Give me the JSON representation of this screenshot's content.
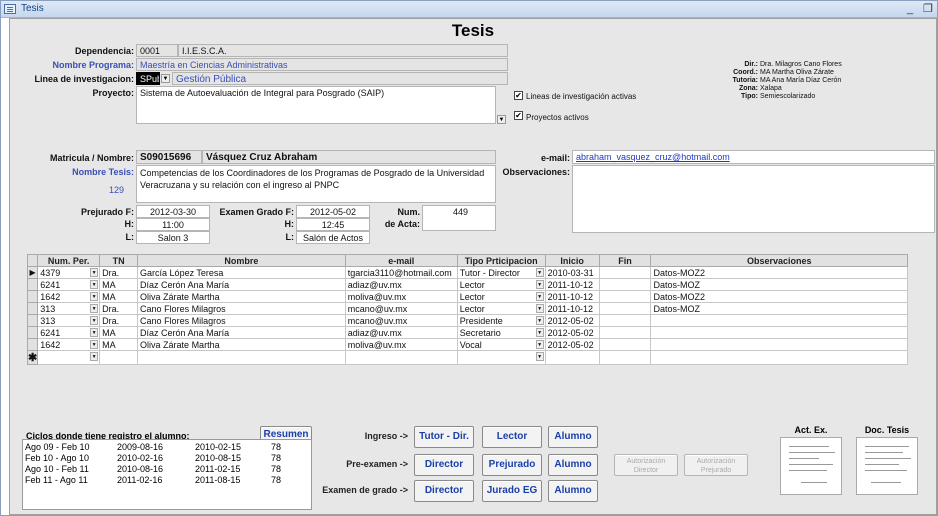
{
  "window": {
    "title": "Tesis",
    "controls": [
      "_",
      "❐"
    ]
  },
  "header": {
    "title": "Tesis"
  },
  "dependencia": {
    "label": "Dependencia:",
    "code": "0001",
    "name": "I.I.E.S.C.A."
  },
  "programa": {
    "label": "Nombre Programa:",
    "value": "Maestría en Ciencias Administrativas"
  },
  "linea": {
    "label": "Linea de investigacion:",
    "code": "SPub",
    "value": "Gestión Pública"
  },
  "proyecto": {
    "label": "Proyecto:",
    "value": "Sistema de Autoevaluación de Integral para Posgrado (SAIP)"
  },
  "options": {
    "lineas_activas": {
      "label": "Lineas de investigación activas",
      "checked": "✔"
    },
    "proyectos_activos": {
      "label": "Proyectos activos",
      "checked": "✔"
    }
  },
  "info": {
    "dir_label": "Dir.:",
    "dir": "Dra. Milagros Cano Flores",
    "coord_label": "Coord.:",
    "coord": "MA Martha Oliva Zárate",
    "tutoria_label": "Tutoria:",
    "tutoria": "MA Ana María Díaz Cerón",
    "zona_label": "Zona:",
    "zona": "Xalapa",
    "tipo_label": "Tipo:",
    "tipo": "Semiescolarizado"
  },
  "alumno": {
    "matricula_label": "Matricula / Nombre:",
    "matricula": "S09015696",
    "nombre": "Vásquez Cruz Abraham",
    "tesis_label": "Nombre Tesis:",
    "tesis": "Competencias de los Coordinadores de los Programas de Posgrado de la Universidad Veracruzana y su relación con el ingreso al PNPC",
    "id": "129",
    "email_label": "e-mail:",
    "email": "abraham_vasquez_cruz@hotmail.com",
    "obs_label": "Observaciones:",
    "obs": ""
  },
  "fechas": {
    "prejurado_label": "Prejurado F:",
    "prejurado_f": "2012-03-30",
    "h_label": "H:",
    "prejurado_h": "11:00",
    "l_label": "L:",
    "prejurado_l": "Salon 3",
    "examen_label": "Examen Grado F:",
    "examen_f": "2012-05-02",
    "examen_h": "12:45",
    "examen_l": "Salón de Actos",
    "num_label": "Num.",
    "acta_label": "de Acta:",
    "num_acta": "449"
  },
  "grid": {
    "headers": [
      "Num. Per.",
      "TN",
      "Nombre",
      "e-mail",
      "Tipo Prticipacion",
      "Inicio",
      "Fin",
      "Observaciones"
    ],
    "rows": [
      {
        "num": "4379",
        "tn": "Dra.",
        "nombre": "García López Teresa",
        "email": "tgarcia3110@hotmail.com",
        "tipo": "Tutor - Director",
        "inicio": "2010-03-31",
        "fin": "",
        "obs": "Datos-MOZ2"
      },
      {
        "num": "6241",
        "tn": "MA",
        "nombre": "Díaz Cerón Ana María",
        "email": "adiaz@uv.mx",
        "tipo": "Lector",
        "inicio": "2011-10-12",
        "fin": "",
        "obs": "Datos-MOZ"
      },
      {
        "num": "1642",
        "tn": "MA",
        "nombre": "Oliva Zárate Martha",
        "email": "moliva@uv.mx",
        "tipo": "Lector",
        "inicio": "2011-10-12",
        "fin": "",
        "obs": "Datos-MOZ2"
      },
      {
        "num": "313",
        "tn": "Dra.",
        "nombre": "Cano Flores Milagros",
        "email": "mcano@uv.mx",
        "tipo": "Lector",
        "inicio": "2011-10-12",
        "fin": "",
        "obs": "Datos-MOZ"
      },
      {
        "num": "313",
        "tn": "Dra.",
        "nombre": "Cano Flores Milagros",
        "email": "mcano@uv.mx",
        "tipo": "Presidente",
        "inicio": "2012-05-02",
        "fin": "",
        "obs": ""
      },
      {
        "num": "6241",
        "tn": "MA",
        "nombre": "Díaz Cerón Ana María",
        "email": "adiaz@uv.mx",
        "tipo": "Secretario",
        "inicio": "2012-05-02",
        "fin": "",
        "obs": ""
      },
      {
        "num": "1642",
        "tn": "MA",
        "nombre": "Oliva Zárate Martha",
        "email": "moliva@uv.mx",
        "tipo": "Vocal",
        "inicio": "2012-05-02",
        "fin": "",
        "obs": ""
      }
    ],
    "current_marker": "▶",
    "new_marker": "✱"
  },
  "ciclos": {
    "title": "Ciclos donde tiene registro el alumno:",
    "resumen": "Resumen",
    "rows": [
      {
        "ciclo": "Ago 09 - Feb 10",
        "inicio": "2009-08-16",
        "fin": "2010-02-15",
        "n": "78"
      },
      {
        "ciclo": "Feb 10 - Ago 10",
        "inicio": "2010-02-16",
        "fin": "2010-08-15",
        "n": "78"
      },
      {
        "ciclo": "Ago 10 - Feb 11",
        "inicio": "2010-08-16",
        "fin": "2011-02-15",
        "n": "78"
      },
      {
        "ciclo": "Feb 11 - Ago 11",
        "inicio": "2011-02-16",
        "fin": "2011-08-15",
        "n": "78"
      }
    ]
  },
  "actions": {
    "ingreso": "Ingreso ->",
    "preexamen": "Pre-examen ->",
    "examen": "Examen de grado ->",
    "tutor_dir": "Tutor - Dir.",
    "lector": "Lector",
    "alumno": "Alumno",
    "director": "Director",
    "prejurado": "Prejurado",
    "jurado_eg": "Jurado EG",
    "aut_director": "Autorización Director",
    "aut_prejurado": "Autorización Prejurado"
  },
  "docs": {
    "act_ex": "Act. Ex.",
    "doc_tesis": "Doc. Tesis"
  }
}
